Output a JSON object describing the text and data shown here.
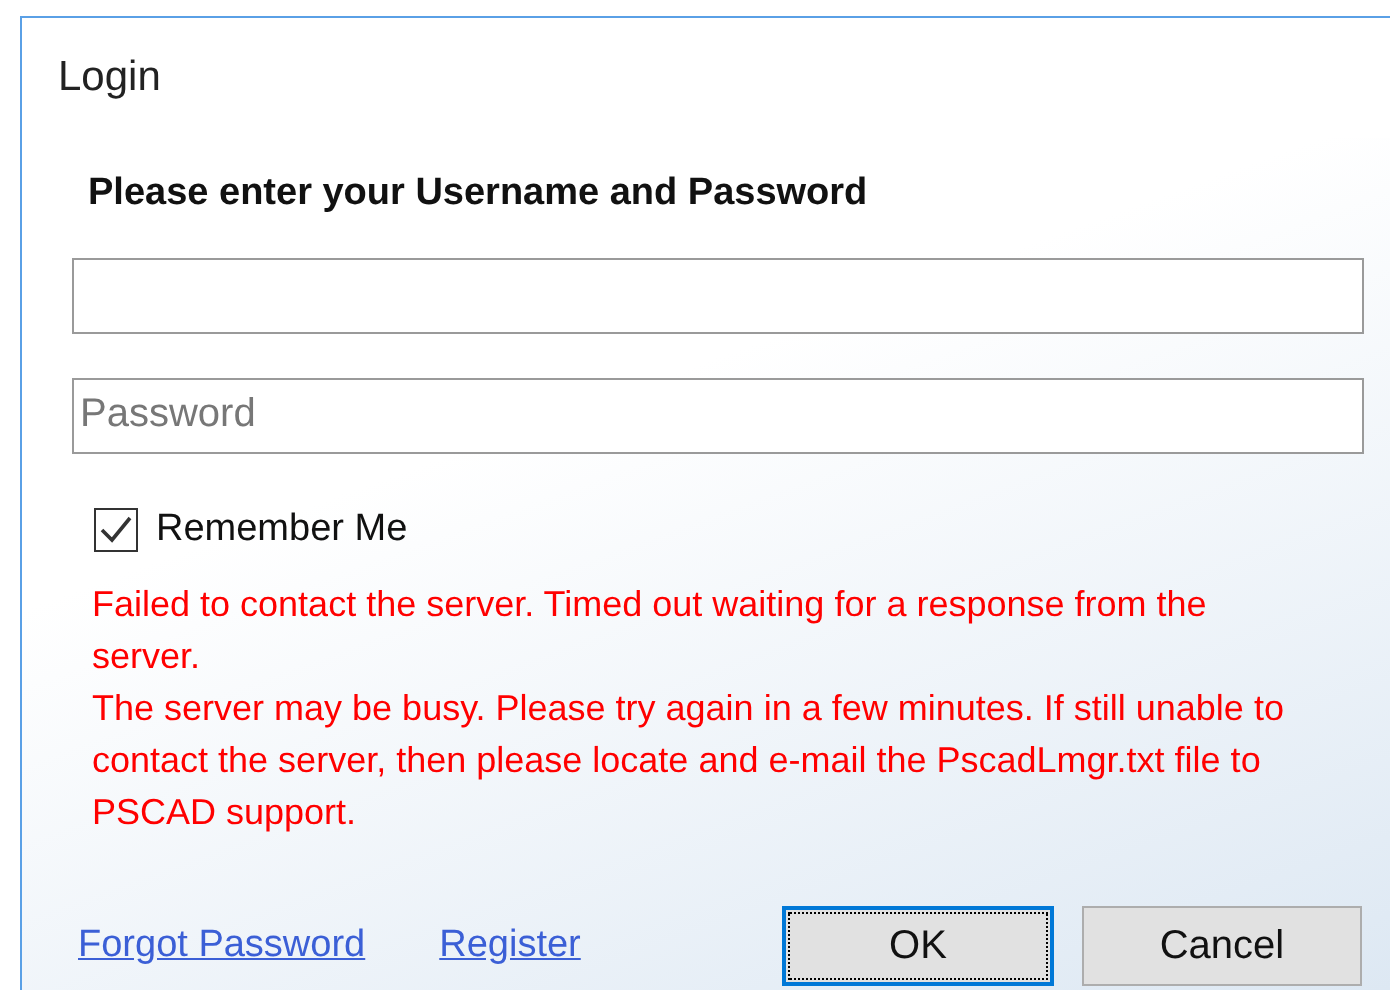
{
  "window": {
    "title": "Login"
  },
  "heading": "Please enter your Username and Password",
  "password": {
    "placeholder": "Password"
  },
  "remember": {
    "label": "Remember Me",
    "checked": true
  },
  "errors": [
    "Failed to contact the server. Timed out waiting for a response from the server.",
    "The server may be busy. Please try again in a few minutes. If still unable to contact the server, then please locate and e-mail the PscadLmgr.txt file to PSCAD support."
  ],
  "links": [
    "Forgot Password",
    "Register"
  ],
  "buttons": [
    {
      "label": "OK",
      "selected": true
    },
    {
      "label": "Cancel",
      "selected": false
    }
  ]
}
